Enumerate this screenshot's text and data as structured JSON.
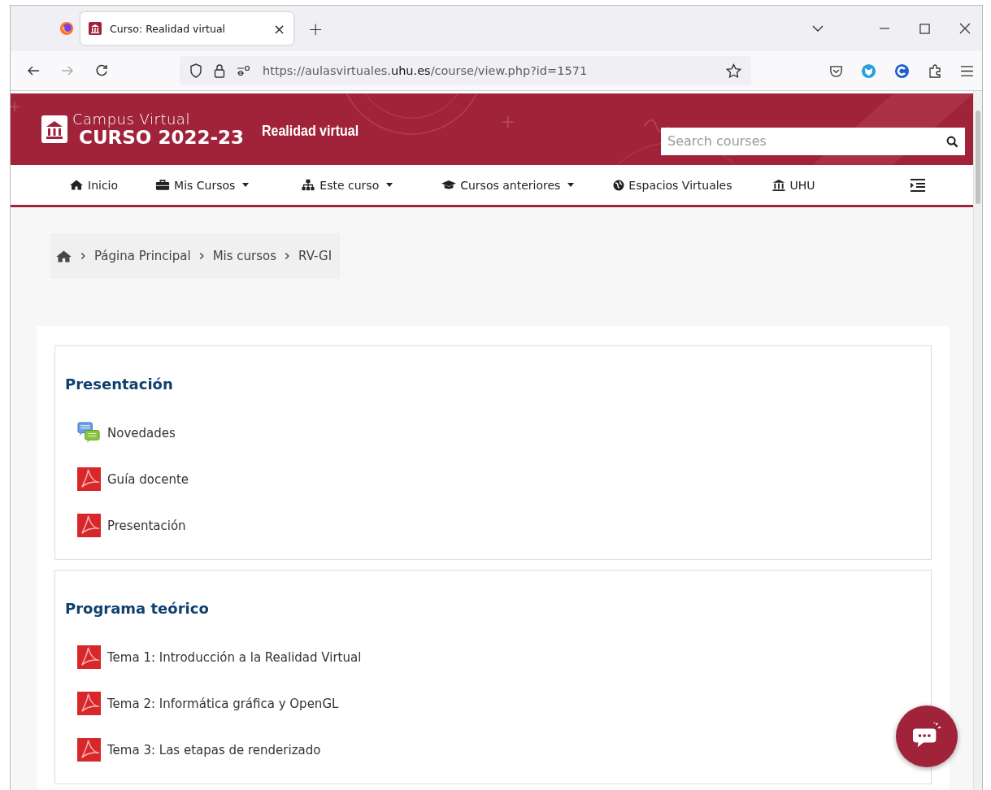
{
  "browser": {
    "tabs": [
      {
        "title": "Curso: Realidad virtual",
        "selected": true,
        "close": "×"
      }
    ],
    "new_tab": "+",
    "url": {
      "prefix": "https://aulasvirtuales.",
      "domain": "uhu.es",
      "path": "/course/view.php?id=1571"
    }
  },
  "header": {
    "logo_line_1": "Campus Virtual",
    "logo_line_2": "CURSO 2022-23",
    "course_title": "Realidad virtual",
    "search": {
      "placeholder": "Search courses"
    }
  },
  "nav": [
    {
      "label": "Inicio",
      "caret": false
    },
    {
      "label": "Mis Cursos",
      "caret": true
    },
    {
      "label": "Este curso",
      "caret": true
    },
    {
      "label": "Cursos anteriores",
      "caret": true
    },
    {
      "label": "Espacios Virtuales",
      "caret": false
    },
    {
      "label": "UHU",
      "caret": false
    }
  ],
  "breadcrumb": [
    "Página Principal",
    "Mis cursos",
    "RV-GI"
  ],
  "sections": [
    {
      "title": "Presentación",
      "activities": [
        {
          "kind": "forum",
          "name": "Novedades"
        },
        {
          "kind": "pdf",
          "name": "Guía docente"
        },
        {
          "kind": "pdf",
          "name": "Presentación"
        }
      ]
    },
    {
      "title": "Programa teórico",
      "activities": [
        {
          "kind": "pdf",
          "name": "Tema 1: Introducción a la Realidad Virtual"
        },
        {
          "kind": "pdf",
          "name": "Tema 2: Informática gráfica y OpenGL"
        },
        {
          "kind": "pdf",
          "name": "Tema 3: Las etapas de renderizado"
        }
      ]
    }
  ]
}
